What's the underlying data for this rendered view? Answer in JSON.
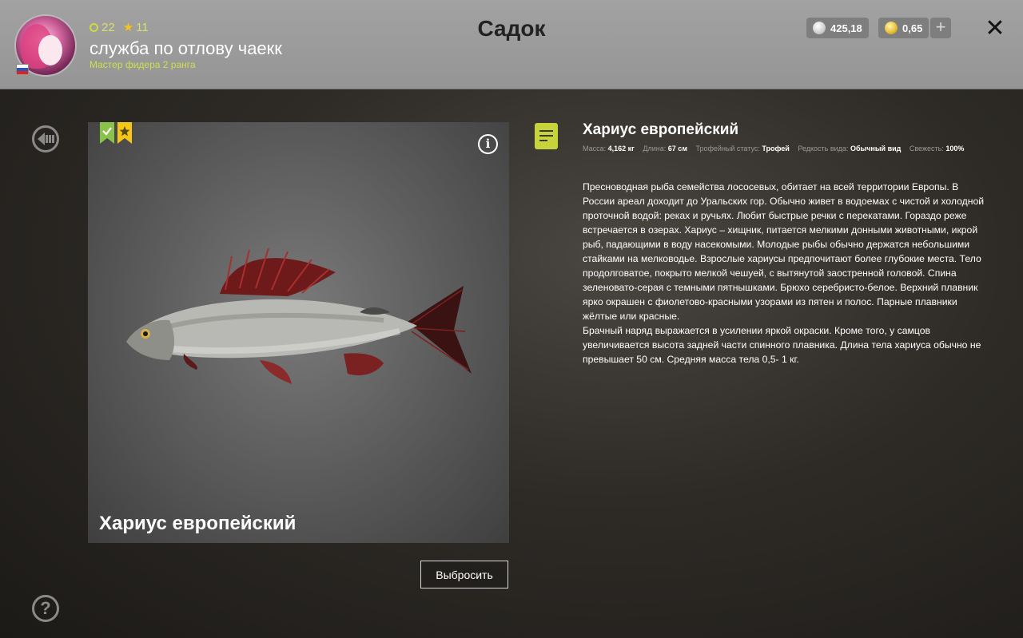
{
  "header": {
    "title": "Садок",
    "user": {
      "level": "22",
      "stars": "11",
      "name": "служба по отлову чаекк",
      "rank": "Мастер фидера 2 ранга"
    },
    "currency": {
      "silver": "425,18",
      "gold": "0,65",
      "add_label": "+"
    },
    "close_label": "✕"
  },
  "fish": {
    "name": "Хариус европейский",
    "stats": {
      "mass_label": "Масса:",
      "mass_value": "4,162 кг",
      "length_label": "Длина:",
      "length_value": "67 см",
      "trophy_label": "Трофейный статус:",
      "trophy_value": "Трофей",
      "rarity_label": "Редкость вида:",
      "rarity_value": "Обычный вид",
      "freshness_label": "Свежесть:",
      "freshness_value": "100%"
    },
    "description_p1": "Пресноводная рыба семейства лососевых, обитает на всей территории Европы. В России ареал доходит до Уральских гор. Обычно живет в водоемах с чистой и холодной проточной водой: реках и ручьях. Любит быстрые речки с перекатами. Гораздо реже встречается в озерах. Хариус – хищник, питается мелкими донными животными, икрой рыб, падающими в воду насекомыми. Молодые рыбы обычно держатся небольшими стайками на мелководье. Взрослые хариусы предпочитают более глубокие места. Тело продолговатое, покрыто мелкой чешуей, с вытянутой заостренной головой. Спина зеленовато-серая с темными пятнышками. Брюхо серебристо-белое. Верхний плавник ярко окрашен с фиолетово-красными узорами из пятен и полос. Парные плавники жёлтые или красные.",
    "description_p2": "Брачный наряд выражается в усилении яркой окраски. Кроме того, у самцов увеличивается высота задней части спинного плавника. Длина тела хариуса обычно не превышает 50 см. Средняя масса тела 0,5- 1 кг."
  },
  "actions": {
    "discard_label": "Выбросить",
    "help_label": "?"
  },
  "colors": {
    "accent_green": "#c7d33a",
    "bookmark_green": "#8bc34a",
    "bookmark_gold": "#f5c518"
  }
}
